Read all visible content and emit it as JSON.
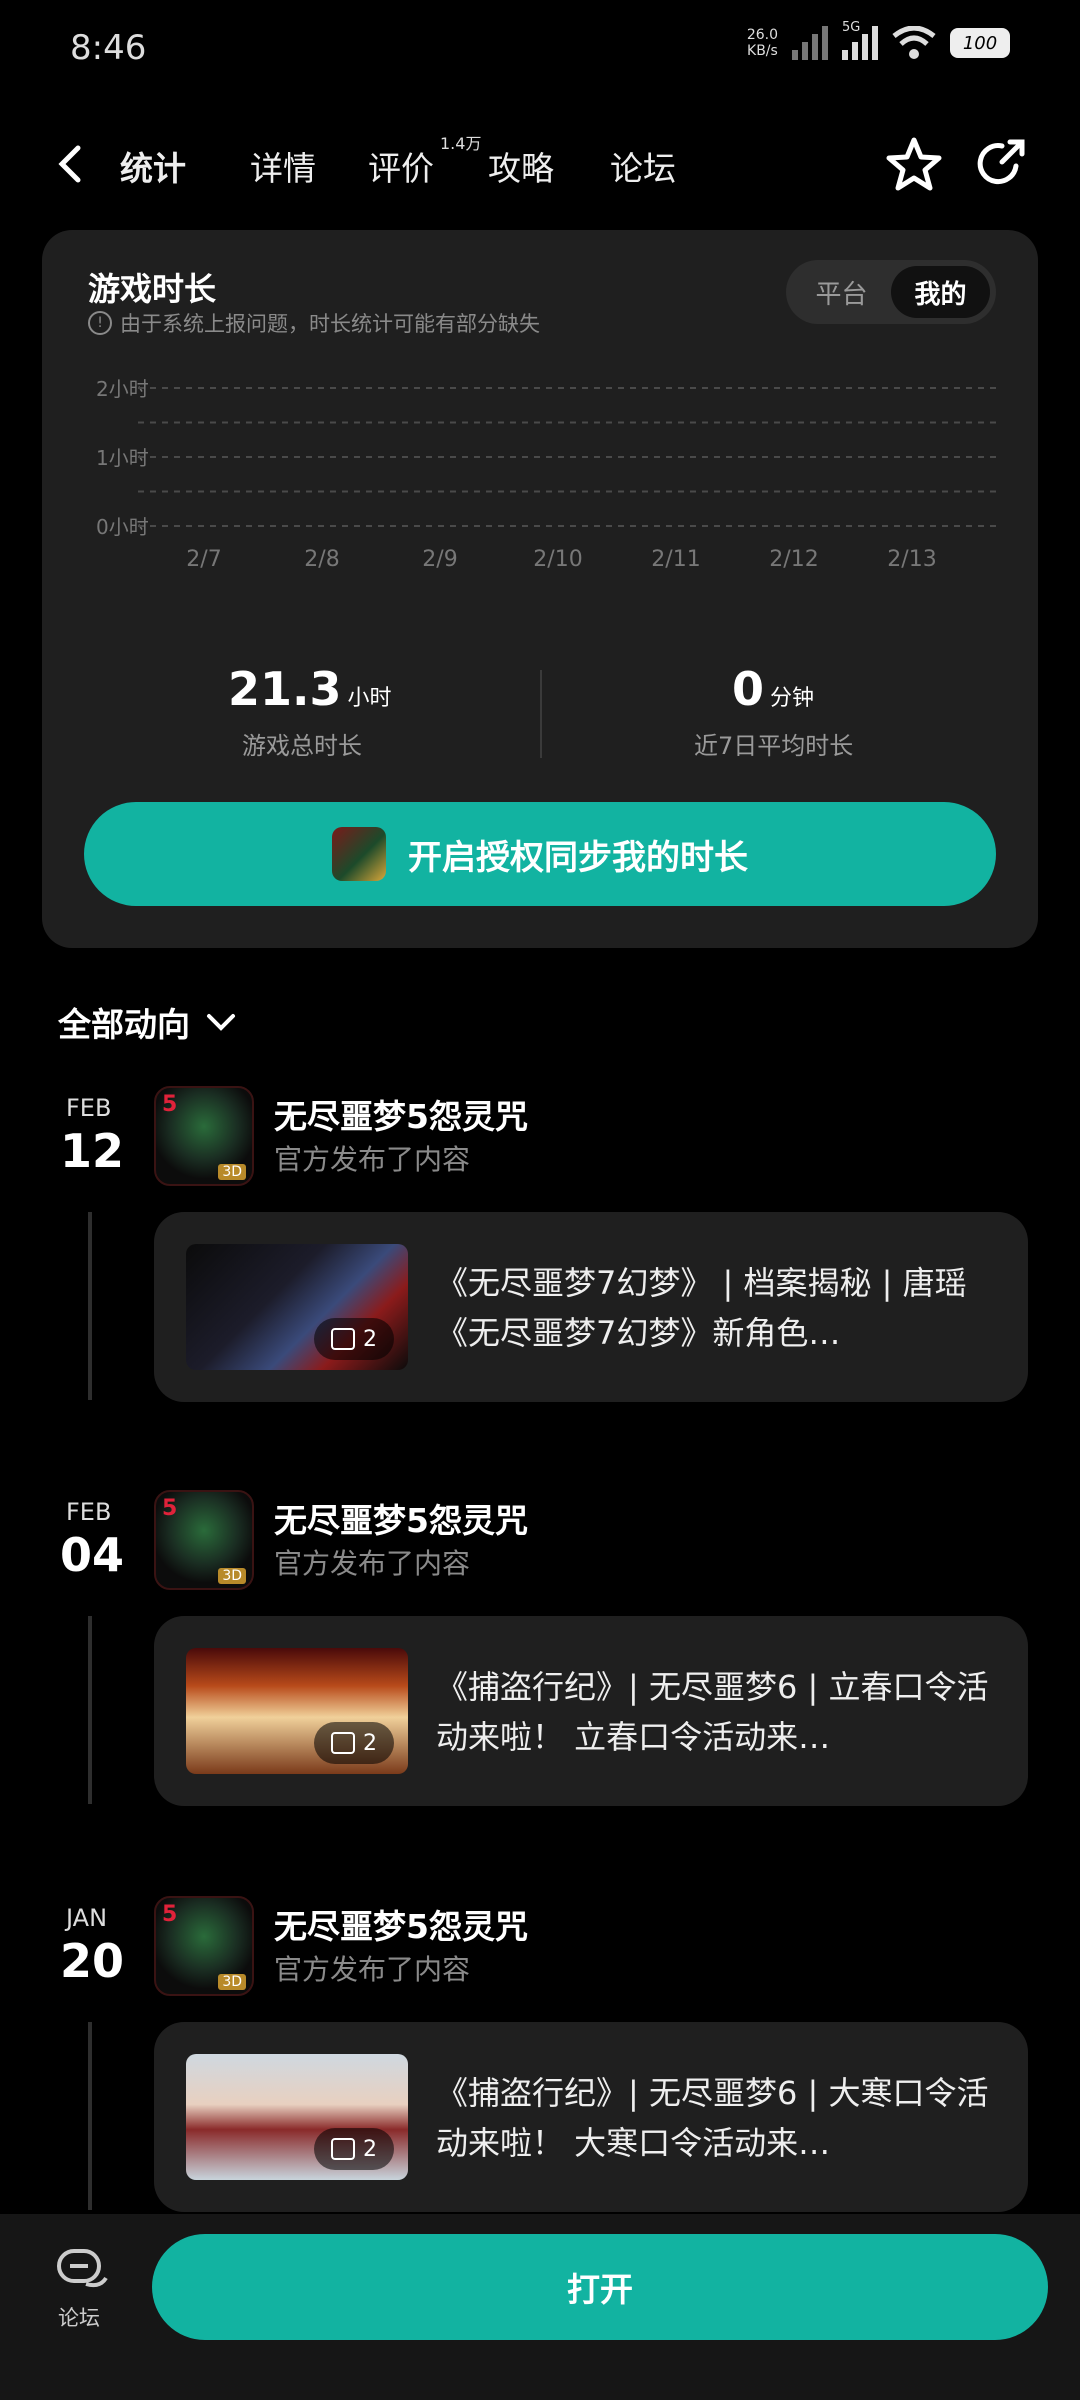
{
  "status": {
    "time": "8:46",
    "net_speed": "26.0",
    "net_unit": "KB/s",
    "net_type": "5G",
    "battery": "100"
  },
  "nav": {
    "tabs": [
      {
        "label": "统计"
      },
      {
        "label": "详情"
      },
      {
        "label": "评价"
      },
      {
        "label": "攻略"
      },
      {
        "label": "论坛"
      }
    ],
    "review_badge": "1.4万"
  },
  "stats": {
    "title": "游戏时长",
    "notice": "由于系统上报问题，时长统计可能有部分缺失",
    "toggle": [
      "平台",
      "我的"
    ],
    "total_value": "21.3",
    "total_unit": "小时",
    "total_label": "游戏总时长",
    "avg_value": "0",
    "avg_unit": "分钟",
    "avg_label": "近7日平均时长",
    "sync_button": "开启授权同步我的时长"
  },
  "chart_data": {
    "type": "bar",
    "categories": [
      "2/7",
      "2/8",
      "2/9",
      "2/10",
      "2/11",
      "2/12",
      "2/13"
    ],
    "values": [
      0,
      0,
      0,
      0,
      0,
      0,
      0
    ],
    "y_ticks": [
      "2小时",
      "1小时",
      "0小时"
    ],
    "ylim": [
      0,
      2
    ],
    "grid": true
  },
  "feed": {
    "header": "全部动向",
    "entries": [
      {
        "month": "FEB",
        "day": "12",
        "game": "无尽噩梦5怨灵咒",
        "sub": "官方发布了内容",
        "image_count": "2",
        "text": "《无尽噩梦7幻梦》 | 档案揭秘 | 唐瑶 《无尽噩梦7幻梦》新角色…"
      },
      {
        "month": "FEB",
        "day": "04",
        "game": "无尽噩梦5怨灵咒",
        "sub": "官方发布了内容",
        "image_count": "2",
        "text": "《捕盗行纪》| 无尽噩梦6 | 立春口令活动来啦！ 立春口令活动来…"
      },
      {
        "month": "JAN",
        "day": "20",
        "game": "无尽噩梦5怨灵咒",
        "sub": "官方发布了内容",
        "image_count": "2",
        "text": "《捕盗行纪》| 无尽噩梦6 | 大寒口令活动来啦！ 大寒口令活动来…"
      }
    ]
  },
  "bottom": {
    "forum_label": "论坛",
    "open_button": "打开"
  }
}
